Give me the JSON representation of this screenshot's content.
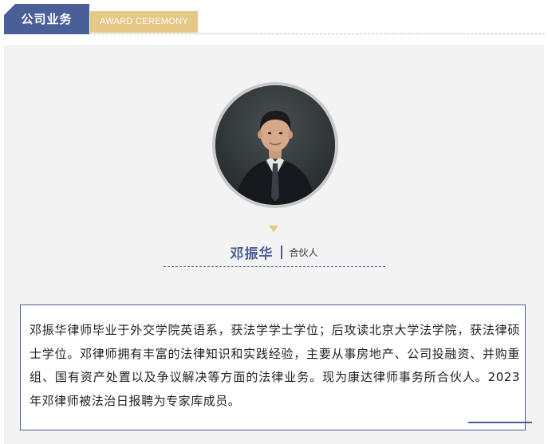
{
  "header": {
    "section_title": "公司业务",
    "tag": "AWARD CEREMONY"
  },
  "profile": {
    "portrait_icon": "person-portrait",
    "name": "邓振华",
    "title": "合伙人"
  },
  "bio": {
    "text": "邓振华律师毕业于外交学院英语系，获法学学士学位；后攻读北京大学法学院，获法律硕士学位。邓律师拥有丰富的法律知识和实践经验，主要从事房地产、公司投融资、并购重组、国有资产处置以及争议解决等方面的法律业务。现为康达律师事务所合伙人。2023年邓律师被法治日报聘为专家库成员。"
  },
  "colors": {
    "accent_blue": "#4a5f97",
    "accent_gold": "#e5c885",
    "panel_bg": "#f3f3f3"
  }
}
